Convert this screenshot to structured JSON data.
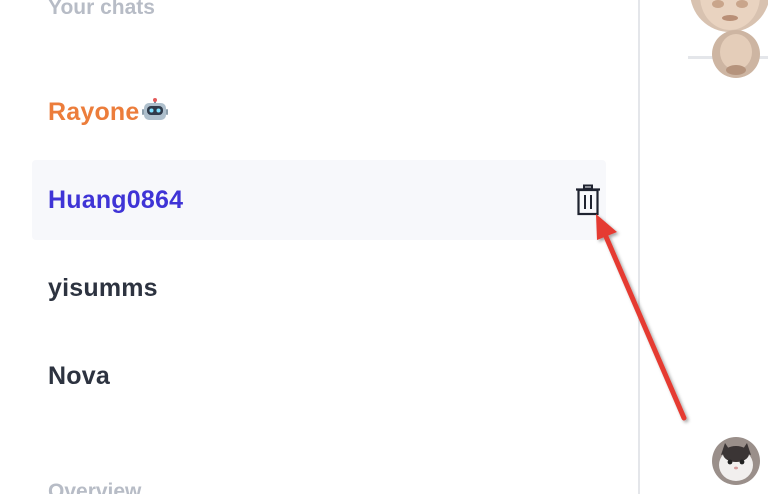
{
  "sidebar": {
    "section_title": "Your chats",
    "overview_title": "Overview",
    "chats": [
      {
        "name": "Rayone",
        "emoji": "robot-emoji",
        "color": "#ec7d3b"
      },
      {
        "name": "Huang0864",
        "color": "#3f34d6",
        "active": true
      },
      {
        "name": "yisumms",
        "color": "#2d3340"
      },
      {
        "name": "Nova",
        "color": "#2d3340"
      }
    ]
  },
  "icons": {
    "delete": "trash-icon",
    "annotation": "red-arrow"
  },
  "colors": {
    "accent_orange": "#ec7d3b",
    "accent_purple": "#3f34d6",
    "annotation_red": "#e53a30"
  }
}
